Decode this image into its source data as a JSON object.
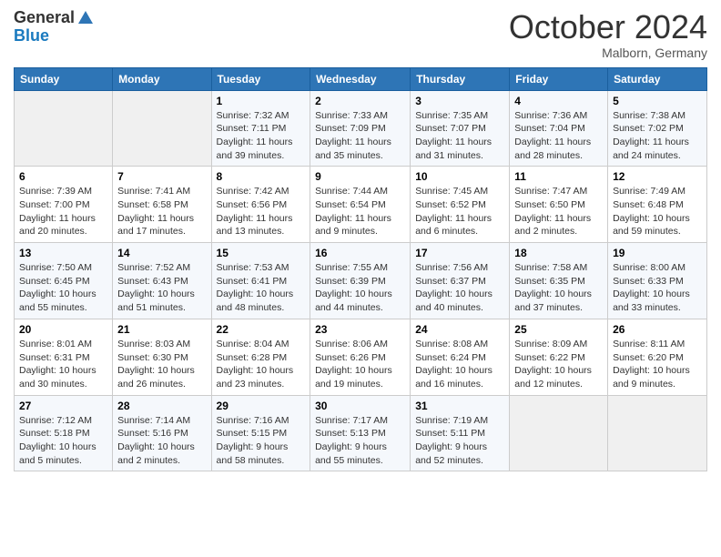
{
  "logo": {
    "line1": "General",
    "line2": "Blue"
  },
  "header": {
    "month": "October 2024",
    "location": "Malborn, Germany"
  },
  "days_of_week": [
    "Sunday",
    "Monday",
    "Tuesday",
    "Wednesday",
    "Thursday",
    "Friday",
    "Saturday"
  ],
  "weeks": [
    [
      null,
      null,
      {
        "day": "1",
        "sunrise": "Sunrise: 7:32 AM",
        "sunset": "Sunset: 7:11 PM",
        "daylight": "Daylight: 11 hours and 39 minutes."
      },
      {
        "day": "2",
        "sunrise": "Sunrise: 7:33 AM",
        "sunset": "Sunset: 7:09 PM",
        "daylight": "Daylight: 11 hours and 35 minutes."
      },
      {
        "day": "3",
        "sunrise": "Sunrise: 7:35 AM",
        "sunset": "Sunset: 7:07 PM",
        "daylight": "Daylight: 11 hours and 31 minutes."
      },
      {
        "day": "4",
        "sunrise": "Sunrise: 7:36 AM",
        "sunset": "Sunset: 7:04 PM",
        "daylight": "Daylight: 11 hours and 28 minutes."
      },
      {
        "day": "5",
        "sunrise": "Sunrise: 7:38 AM",
        "sunset": "Sunset: 7:02 PM",
        "daylight": "Daylight: 11 hours and 24 minutes."
      }
    ],
    [
      {
        "day": "6",
        "sunrise": "Sunrise: 7:39 AM",
        "sunset": "Sunset: 7:00 PM",
        "daylight": "Daylight: 11 hours and 20 minutes."
      },
      {
        "day": "7",
        "sunrise": "Sunrise: 7:41 AM",
        "sunset": "Sunset: 6:58 PM",
        "daylight": "Daylight: 11 hours and 17 minutes."
      },
      {
        "day": "8",
        "sunrise": "Sunrise: 7:42 AM",
        "sunset": "Sunset: 6:56 PM",
        "daylight": "Daylight: 11 hours and 13 minutes."
      },
      {
        "day": "9",
        "sunrise": "Sunrise: 7:44 AM",
        "sunset": "Sunset: 6:54 PM",
        "daylight": "Daylight: 11 hours and 9 minutes."
      },
      {
        "day": "10",
        "sunrise": "Sunrise: 7:45 AM",
        "sunset": "Sunset: 6:52 PM",
        "daylight": "Daylight: 11 hours and 6 minutes."
      },
      {
        "day": "11",
        "sunrise": "Sunrise: 7:47 AM",
        "sunset": "Sunset: 6:50 PM",
        "daylight": "Daylight: 11 hours and 2 minutes."
      },
      {
        "day": "12",
        "sunrise": "Sunrise: 7:49 AM",
        "sunset": "Sunset: 6:48 PM",
        "daylight": "Daylight: 10 hours and 59 minutes."
      }
    ],
    [
      {
        "day": "13",
        "sunrise": "Sunrise: 7:50 AM",
        "sunset": "Sunset: 6:45 PM",
        "daylight": "Daylight: 10 hours and 55 minutes."
      },
      {
        "day": "14",
        "sunrise": "Sunrise: 7:52 AM",
        "sunset": "Sunset: 6:43 PM",
        "daylight": "Daylight: 10 hours and 51 minutes."
      },
      {
        "day": "15",
        "sunrise": "Sunrise: 7:53 AM",
        "sunset": "Sunset: 6:41 PM",
        "daylight": "Daylight: 10 hours and 48 minutes."
      },
      {
        "day": "16",
        "sunrise": "Sunrise: 7:55 AM",
        "sunset": "Sunset: 6:39 PM",
        "daylight": "Daylight: 10 hours and 44 minutes."
      },
      {
        "day": "17",
        "sunrise": "Sunrise: 7:56 AM",
        "sunset": "Sunset: 6:37 PM",
        "daylight": "Daylight: 10 hours and 40 minutes."
      },
      {
        "day": "18",
        "sunrise": "Sunrise: 7:58 AM",
        "sunset": "Sunset: 6:35 PM",
        "daylight": "Daylight: 10 hours and 37 minutes."
      },
      {
        "day": "19",
        "sunrise": "Sunrise: 8:00 AM",
        "sunset": "Sunset: 6:33 PM",
        "daylight": "Daylight: 10 hours and 33 minutes."
      }
    ],
    [
      {
        "day": "20",
        "sunrise": "Sunrise: 8:01 AM",
        "sunset": "Sunset: 6:31 PM",
        "daylight": "Daylight: 10 hours and 30 minutes."
      },
      {
        "day": "21",
        "sunrise": "Sunrise: 8:03 AM",
        "sunset": "Sunset: 6:30 PM",
        "daylight": "Daylight: 10 hours and 26 minutes."
      },
      {
        "day": "22",
        "sunrise": "Sunrise: 8:04 AM",
        "sunset": "Sunset: 6:28 PM",
        "daylight": "Daylight: 10 hours and 23 minutes."
      },
      {
        "day": "23",
        "sunrise": "Sunrise: 8:06 AM",
        "sunset": "Sunset: 6:26 PM",
        "daylight": "Daylight: 10 hours and 19 minutes."
      },
      {
        "day": "24",
        "sunrise": "Sunrise: 8:08 AM",
        "sunset": "Sunset: 6:24 PM",
        "daylight": "Daylight: 10 hours and 16 minutes."
      },
      {
        "day": "25",
        "sunrise": "Sunrise: 8:09 AM",
        "sunset": "Sunset: 6:22 PM",
        "daylight": "Daylight: 10 hours and 12 minutes."
      },
      {
        "day": "26",
        "sunrise": "Sunrise: 8:11 AM",
        "sunset": "Sunset: 6:20 PM",
        "daylight": "Daylight: 10 hours and 9 minutes."
      }
    ],
    [
      {
        "day": "27",
        "sunrise": "Sunrise: 7:12 AM",
        "sunset": "Sunset: 5:18 PM",
        "daylight": "Daylight: 10 hours and 5 minutes."
      },
      {
        "day": "28",
        "sunrise": "Sunrise: 7:14 AM",
        "sunset": "Sunset: 5:16 PM",
        "daylight": "Daylight: 10 hours and 2 minutes."
      },
      {
        "day": "29",
        "sunrise": "Sunrise: 7:16 AM",
        "sunset": "Sunset: 5:15 PM",
        "daylight": "Daylight: 9 hours and 58 minutes."
      },
      {
        "day": "30",
        "sunrise": "Sunrise: 7:17 AM",
        "sunset": "Sunset: 5:13 PM",
        "daylight": "Daylight: 9 hours and 55 minutes."
      },
      {
        "day": "31",
        "sunrise": "Sunrise: 7:19 AM",
        "sunset": "Sunset: 5:11 PM",
        "daylight": "Daylight: 9 hours and 52 minutes."
      },
      null,
      null
    ]
  ]
}
